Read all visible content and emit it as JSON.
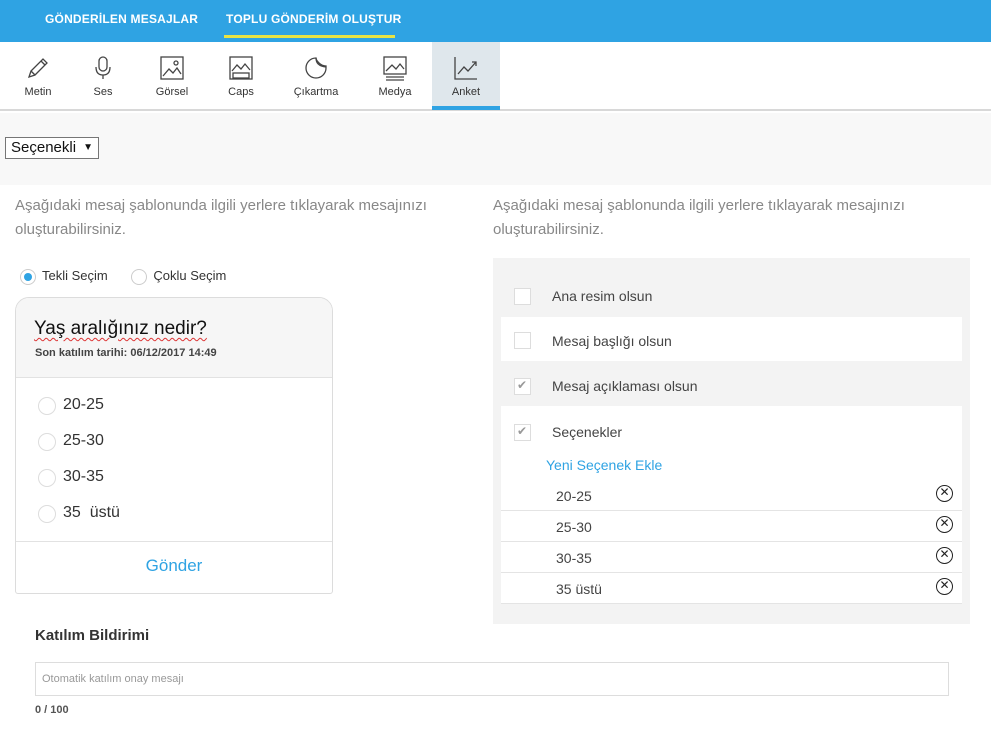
{
  "topnav": {
    "tabs": [
      {
        "label": "GÖNDERİLEN MESAJLAR"
      },
      {
        "label": "TOPLU GÖNDERİM OLUŞTUR"
      }
    ],
    "active_color": "#e8e344",
    "bg_color": "#2fa3e3"
  },
  "toolbar": {
    "items": [
      {
        "label": "Metin",
        "icon": "pencil-icon"
      },
      {
        "label": "Ses",
        "icon": "microphone-icon"
      },
      {
        "label": "Görsel",
        "icon": "image-icon"
      },
      {
        "label": "Caps",
        "icon": "caps-icon"
      },
      {
        "label": "Çıkartma",
        "icon": "sticker-icon"
      },
      {
        "label": "Medya",
        "icon": "media-icon"
      },
      {
        "label": "Anket",
        "icon": "chart-icon",
        "active": true
      }
    ]
  },
  "type_select": {
    "value": "Seçenekli"
  },
  "hint_left": "Aşağıdaki mesaj şablonunda ilgili yerlere tıklayarak mesajınızı oluşturabilirsiniz.",
  "hint_right": "Aşağıdaki mesaj şablonunda ilgili yerlere tıklayarak mesajınızı oluşturabilirsiniz.",
  "selection_mode": {
    "single": "Tekli Seçim",
    "multiple": "Çoklu Seçim",
    "selected": "single"
  },
  "preview": {
    "question": "Yaş aralığınız nedir?",
    "deadline": "Son katılım tarihi: 06/12/2017 14:49",
    "options": [
      "20-25",
      "25-30",
      "30-35",
      "35  üstü"
    ],
    "send_label": "Gönder"
  },
  "settings": {
    "main_image": {
      "label": "Ana resim olsun",
      "checked": false
    },
    "title": {
      "label": "Mesaj başlığı olsun",
      "checked": false
    },
    "description": {
      "label": "Mesaj açıklaması olsun",
      "checked": true
    },
    "choices": {
      "label": "Seçenekler",
      "checked": true
    },
    "add_choice": "Yeni Seçenek Ekle",
    "choice_items": [
      "20-25",
      "25-30",
      "30-35",
      "35 üstü"
    ]
  },
  "notification": {
    "title": "Katılım Bildirimi",
    "placeholder": "Otomatik katılım onay mesajı",
    "counter": "0 / 100"
  }
}
